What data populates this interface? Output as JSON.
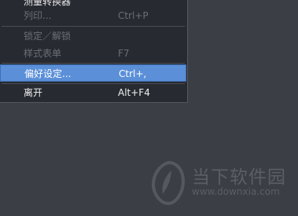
{
  "menu": {
    "items": [
      {
        "label": "测量转换器",
        "shortcut": ""
      },
      {
        "label": "列印...",
        "shortcut": "Ctrl+P"
      },
      {
        "label": "锁定／解锁",
        "shortcut": ""
      },
      {
        "label": "样式表单",
        "shortcut": "F7"
      },
      {
        "label": "偏好设定...",
        "shortcut": "Ctrl+,"
      },
      {
        "label": "离开",
        "shortcut": "Alt+F4"
      }
    ],
    "selected_item": "偏好设定..."
  },
  "watermark": {
    "name": "当下软件园",
    "url": "www.downxia.com"
  },
  "colors": {
    "background": "#3c3e45",
    "menu_background": "#272a31",
    "selection": "#5b8fd8",
    "disabled_text": "#6b6e76"
  }
}
